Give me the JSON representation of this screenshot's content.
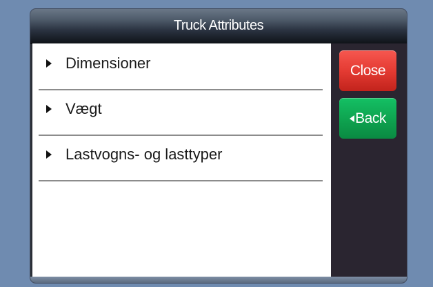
{
  "window": {
    "title": "Truck Attributes"
  },
  "list": {
    "items": [
      {
        "label": "Dimensioner"
      },
      {
        "label": "Vægt"
      },
      {
        "label": "Lastvogns- og lasttyper"
      }
    ]
  },
  "sidebar": {
    "close_label": "Close",
    "back_label": "Back"
  },
  "icons": {
    "item_arrow": "triangle-right-icon",
    "back_arrow": "triangle-left-icon"
  },
  "colors": {
    "close_button": "#e43b33",
    "back_button": "#0ea24f",
    "background": "#6f8bb0"
  }
}
